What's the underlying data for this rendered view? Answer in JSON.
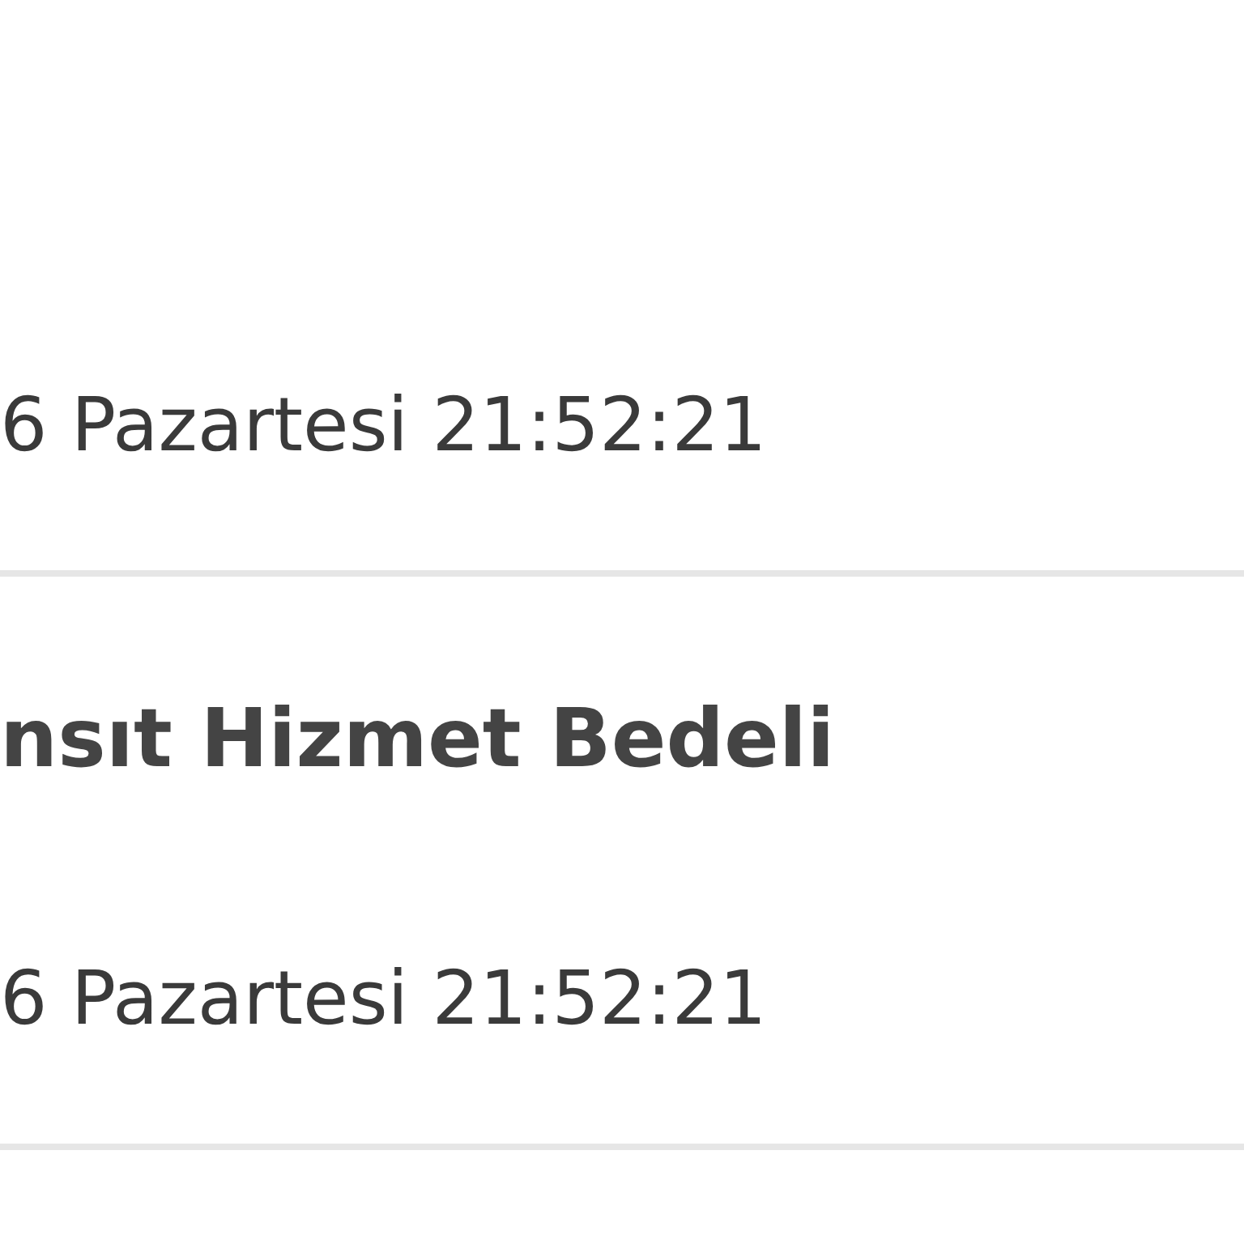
{
  "transactions": [
    {
      "date": "6 Pazartesi 21:52:21"
    },
    {
      "title": "nsıt Hizmet Bedeli",
      "date": "6 Pazartesi 21:52:21"
    }
  ]
}
